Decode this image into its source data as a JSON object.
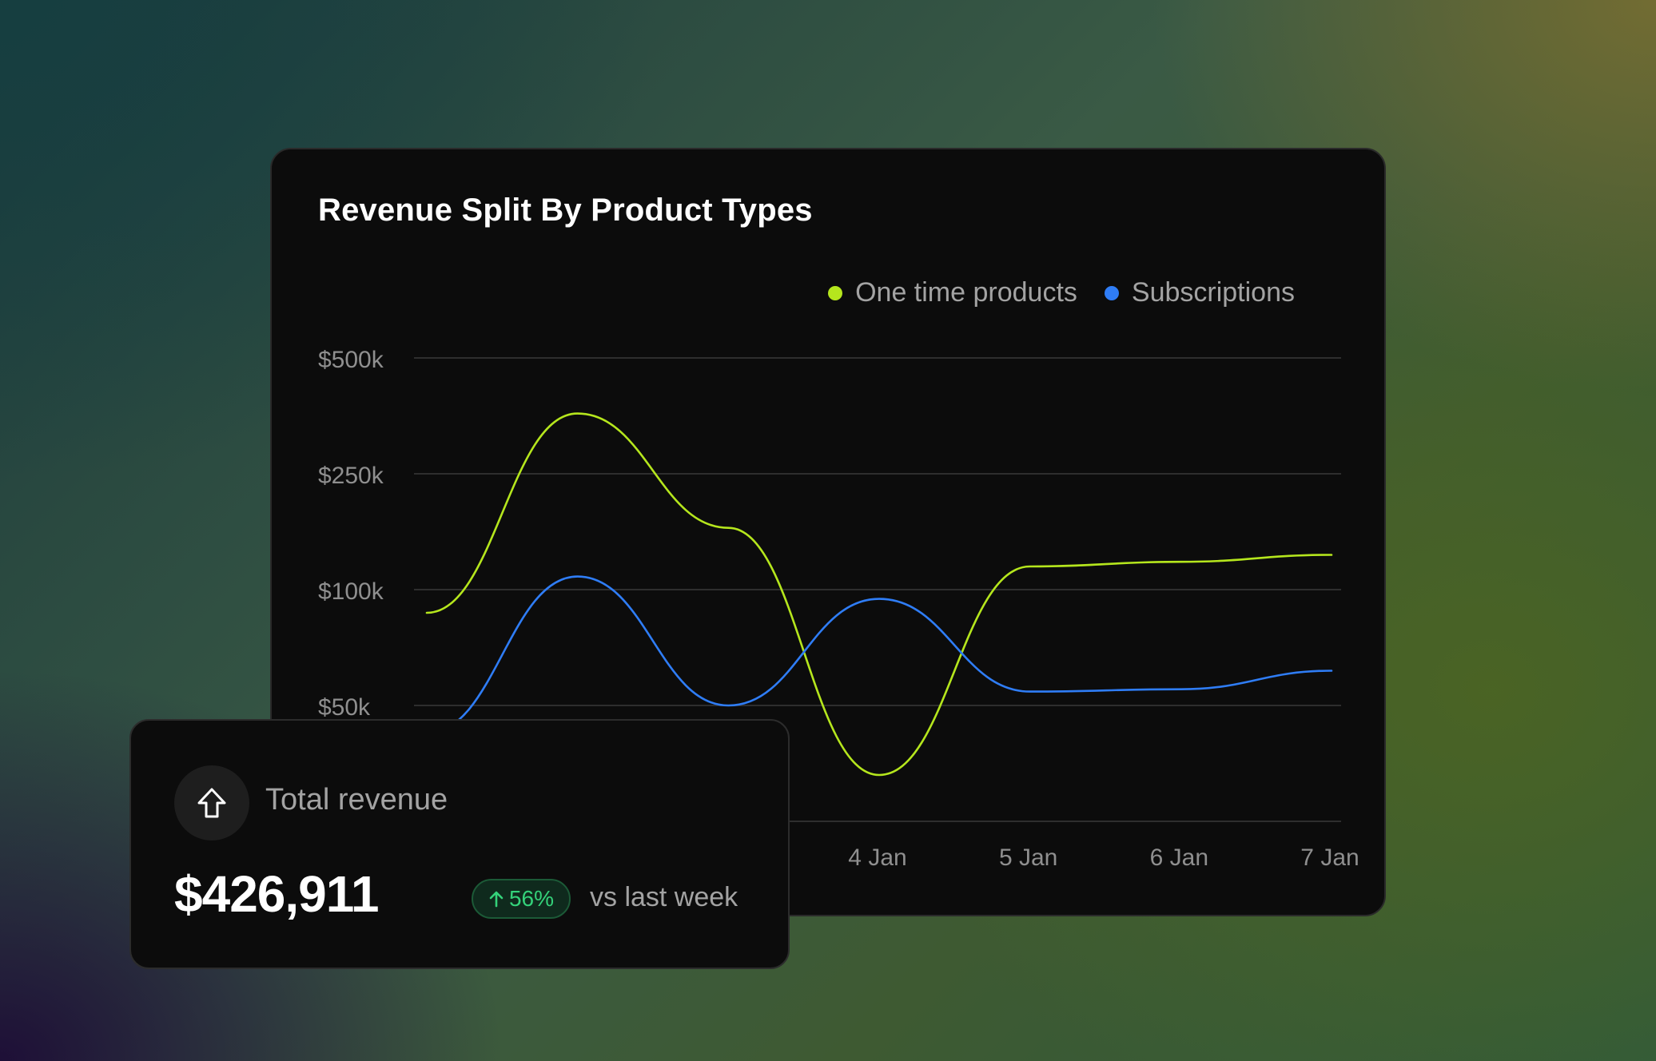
{
  "card": {
    "title": "Revenue Split By Product Types"
  },
  "legend": [
    {
      "label": "One time products",
      "color": "#b5e61d"
    },
    {
      "label": "Subscriptions",
      "color": "#2f7df6"
    }
  ],
  "chart_data": {
    "type": "line",
    "title": "Revenue Split By Product Types",
    "xlabel": "",
    "ylabel": "",
    "y_scale": "non-linear (equal spacing between ticks)",
    "yticks": [
      0,
      50000,
      100000,
      250000,
      500000
    ],
    "ytick_labels": [
      "$500k",
      "$250k",
      "$100k",
      "$50k"
    ],
    "x_tick_labels": [
      "4 Jan",
      "5 Jan",
      "6 Jan",
      "7 Jan"
    ],
    "x": [
      "1 Jan",
      "2 Jan",
      "3 Jan",
      "4 Jan",
      "5 Jan",
      "6 Jan",
      "7 Jan"
    ],
    "series": [
      {
        "name": "One time products",
        "color": "#b5e61d",
        "values": [
          90000,
          380000,
          180000,
          20000,
          130000,
          136000,
          145000
        ]
      },
      {
        "name": "Subscriptions",
        "color": "#2f7df6",
        "values": [
          38000,
          117000,
          50000,
          96000,
          56000,
          57000,
          65000
        ]
      }
    ],
    "grid": true,
    "legend_position": "top-right"
  },
  "summary": {
    "icon": "arrow-up-icon",
    "label": "Total revenue",
    "value": "$426,911",
    "change": "56%",
    "change_color": "#34d27a",
    "compare": "vs last week"
  }
}
